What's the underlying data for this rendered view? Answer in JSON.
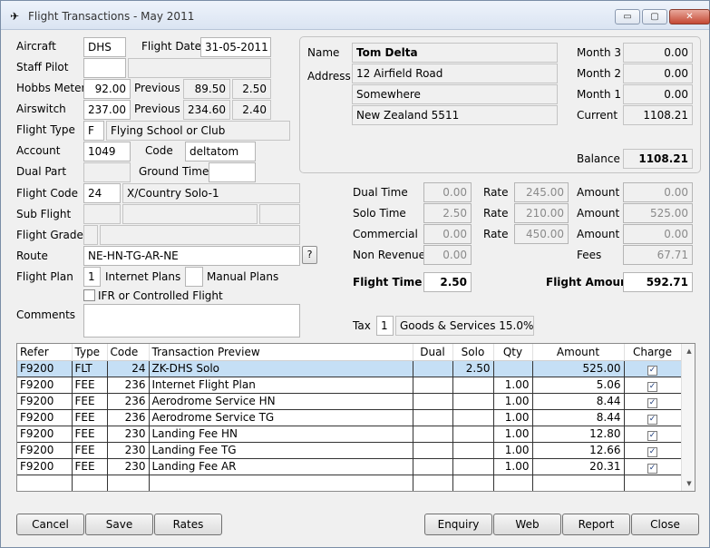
{
  "window": {
    "title": "Flight Transactions - May 2011",
    "minimize": "▭",
    "maximize": "▢",
    "close": "✕"
  },
  "form": {
    "aircraft_label": "Aircraft",
    "aircraft": "DHS",
    "flight_date_label": "Flight Date",
    "flight_date": "31-05-2011",
    "staff_pilot_label": "Staff Pilot",
    "staff_pilot": "",
    "staff_pilot_name": "",
    "hobbs_label": "Hobbs Meter",
    "hobbs": "92.00",
    "hobbs_prev_label": "Previous",
    "hobbs_prev": "89.50",
    "hobbs_diff": "2.50",
    "airswitch_label": "Airswitch",
    "airswitch": "237.00",
    "airswitch_prev_label": "Previous",
    "airswitch_prev": "234.60",
    "airswitch_diff": "2.40",
    "flight_type_label": "Flight Type",
    "flight_type": "F",
    "flight_type_desc": "Flying School or Club",
    "account_label": "Account",
    "account": "1049",
    "code_label": "Code",
    "code": "deltatom",
    "dual_part_label": "Dual Part",
    "ground_time_label": "Ground Time",
    "ground_time": "",
    "flight_code_label": "Flight Code",
    "flight_code": "24",
    "flight_code_desc": "X/Country Solo-1",
    "sub_flight_label": "Sub Flight",
    "flight_grade_label": "Flight Grade",
    "route_label": "Route",
    "route": "NE-HN-TG-AR-NE",
    "route_help": "?",
    "flight_plan_label": "Flight Plan",
    "internet_plans": "1",
    "internet_plans_label": "Internet Plans",
    "manual_plans": "",
    "manual_plans_label": "Manual Plans",
    "ifr_label": "IFR or Controlled Flight",
    "comments_label": "Comments",
    "comments": ""
  },
  "member": {
    "name_label": "Name",
    "name": "Tom Delta",
    "address_label": "Address",
    "address1": "12 Airfield Road",
    "address2": "Somewhere",
    "address3": "New Zealand 5511",
    "month3_label": "Month 3",
    "month3": "0.00",
    "month2_label": "Month 2",
    "month2": "0.00",
    "month1_label": "Month 1",
    "month1": "0.00",
    "current_label": "Current",
    "current": "1108.21",
    "balance_label": "Balance",
    "balance": "1108.21"
  },
  "charges": {
    "dual_time_label": "Dual Time",
    "dual_time": "0.00",
    "dual_rate": "245.00",
    "dual_amount": "0.00",
    "solo_time_label": "Solo Time",
    "solo_time": "2.50",
    "solo_rate": "210.00",
    "solo_amount": "525.00",
    "commercial_label": "Commercial",
    "commercial_time": "0.00",
    "commercial_rate": "450.00",
    "commercial_amount": "0.00",
    "non_revenue_label": "Non Revenue",
    "non_revenue": "0.00",
    "fees_label": "Fees",
    "fees": "67.71",
    "rate_label": "Rate",
    "amount_label": "Amount",
    "flight_time_label": "Flight Time",
    "flight_time": "2.50",
    "flight_amount_label": "Flight Amount",
    "flight_amount": "592.71",
    "tax_label": "Tax",
    "tax_code": "1",
    "tax_desc": "Goods & Services 15.0%"
  },
  "grid": {
    "headers": {
      "refer": "Refer",
      "type": "Type",
      "code": "Code",
      "preview": "Transaction Preview",
      "dual": "Dual",
      "solo": "Solo",
      "qty": "Qty",
      "amount": "Amount",
      "charge": "Charge"
    },
    "rows": [
      {
        "refer": "F9200",
        "type": "FLT",
        "code": "24",
        "preview": "ZK-DHS Solo",
        "dual": "",
        "solo": "2.50",
        "qty": "",
        "amount": "525.00",
        "charge": "✓"
      },
      {
        "refer": "F9200",
        "type": "FEE",
        "code": "236",
        "preview": "Internet Flight Plan",
        "dual": "",
        "solo": "",
        "qty": "1.00",
        "amount": "5.06",
        "charge": "✓"
      },
      {
        "refer": "F9200",
        "type": "FEE",
        "code": "236",
        "preview": "Aerodrome Service HN",
        "dual": "",
        "solo": "",
        "qty": "1.00",
        "amount": "8.44",
        "charge": "✓"
      },
      {
        "refer": "F9200",
        "type": "FEE",
        "code": "236",
        "preview": "Aerodrome Service TG",
        "dual": "",
        "solo": "",
        "qty": "1.00",
        "amount": "8.44",
        "charge": "✓"
      },
      {
        "refer": "F9200",
        "type": "FEE",
        "code": "230",
        "preview": "Landing Fee HN",
        "dual": "",
        "solo": "",
        "qty": "1.00",
        "amount": "12.80",
        "charge": "✓"
      },
      {
        "refer": "F9200",
        "type": "FEE",
        "code": "230",
        "preview": "Landing Fee TG",
        "dual": "",
        "solo": "",
        "qty": "1.00",
        "amount": "12.66",
        "charge": "✓"
      },
      {
        "refer": "F9200",
        "type": "FEE",
        "code": "230",
        "preview": "Landing Fee AR",
        "dual": "",
        "solo": "",
        "qty": "1.00",
        "amount": "20.31",
        "charge": "✓"
      }
    ]
  },
  "buttons": {
    "cancel": "Cancel",
    "save": "Save",
    "rates": "Rates",
    "enquiry": "Enquiry",
    "web": "Web",
    "report": "Report",
    "close": "Close"
  }
}
